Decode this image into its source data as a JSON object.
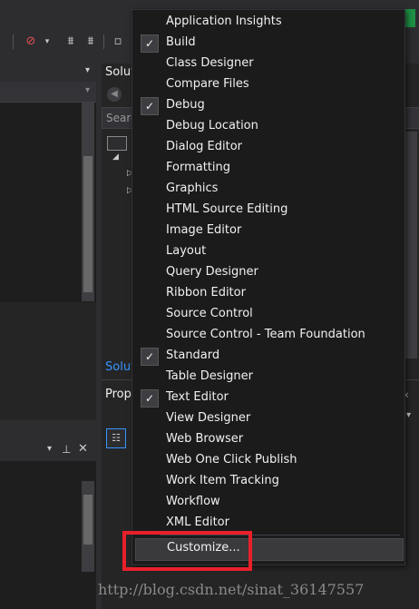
{
  "toolbar": {
    "icons": [
      "debug-breakpoints-icon",
      "dropdown-arrow-icon",
      "add-bookmark-icon",
      "remove-bookmark-icon",
      "toggle-icon"
    ]
  },
  "solution_explorer": {
    "title": "Solut",
    "search_placeholder": "Searc",
    "footer_tab": "Solut"
  },
  "properties": {
    "title": "Prop"
  },
  "menu": {
    "items": [
      {
        "label": "Application Insights",
        "checked": false
      },
      {
        "label": "Build",
        "checked": true
      },
      {
        "label": "Class Designer",
        "checked": false
      },
      {
        "label": "Compare Files",
        "checked": false
      },
      {
        "label": "Debug",
        "checked": true
      },
      {
        "label": "Debug Location",
        "checked": false
      },
      {
        "label": "Dialog Editor",
        "checked": false
      },
      {
        "label": "Formatting",
        "checked": false
      },
      {
        "label": "Graphics",
        "checked": false
      },
      {
        "label": "HTML Source Editing",
        "checked": false
      },
      {
        "label": "Image Editor",
        "checked": false
      },
      {
        "label": "Layout",
        "checked": false
      },
      {
        "label": "Query Designer",
        "checked": false
      },
      {
        "label": "Ribbon Editor",
        "checked": false
      },
      {
        "label": "Source Control",
        "checked": false
      },
      {
        "label": "Source Control - Team Foundation",
        "checked": false
      },
      {
        "label": "Standard",
        "checked": true
      },
      {
        "label": "Table Designer",
        "checked": false
      },
      {
        "label": "Text Editor",
        "checked": true
      },
      {
        "label": "View Designer",
        "checked": false
      },
      {
        "label": "Web Browser",
        "checked": false
      },
      {
        "label": "Web One Click Publish",
        "checked": false
      },
      {
        "label": "Work Item Tracking",
        "checked": false
      },
      {
        "label": "Workflow",
        "checked": false
      },
      {
        "label": "XML Editor",
        "checked": false
      }
    ],
    "customize_label": "Customize...",
    "check_glyph": "✓"
  },
  "watermark": "http://blog.csdn.net/sinat_36147557",
  "colors": {
    "menu_bg": "#1b1b1c",
    "highlight": "#e8202a",
    "link_blue": "#3794ff"
  }
}
